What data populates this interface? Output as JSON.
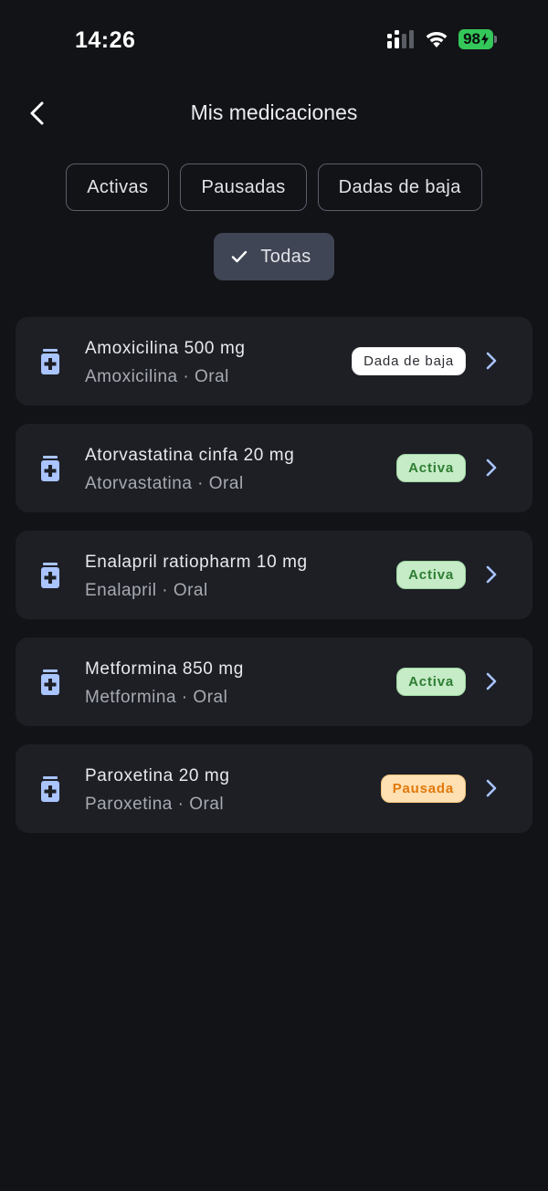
{
  "status_bar": {
    "time": "14:26",
    "battery": "98"
  },
  "header": {
    "title": "Mis medicaciones"
  },
  "filters": {
    "chips": [
      {
        "label": "Activas",
        "selected": false
      },
      {
        "label": "Pausadas",
        "selected": false
      },
      {
        "label": "Dadas de baja",
        "selected": false
      },
      {
        "label": "Todas",
        "selected": true
      }
    ]
  },
  "medications": [
    {
      "name": "Amoxicilina 500 mg",
      "subtitle": "Amoxicilina · Oral",
      "status": "Dada de baja",
      "status_type": "baja"
    },
    {
      "name": "Atorvastatina cinfa 20 mg",
      "subtitle": "Atorvastatina · Oral",
      "status": "Activa",
      "status_type": "activa"
    },
    {
      "name": "Enalapril ratiopharm 10 mg",
      "subtitle": "Enalapril · Oral",
      "status": "Activa",
      "status_type": "activa"
    },
    {
      "name": "Metformina 850 mg",
      "subtitle": "Metformina · Oral",
      "status": "Activa",
      "status_type": "activa"
    },
    {
      "name": "Paroxetina 20 mg",
      "subtitle": "Paroxetina · Oral",
      "status": "Pausada",
      "status_type": "pausada"
    }
  ],
  "colors": {
    "background": "#121317",
    "card": "#1d1f25",
    "icon_accent": "#a9c4ff",
    "chevron": "#a9c4ff",
    "active_badge_bg": "#c6ebc7",
    "active_badge_text": "#2e7d32",
    "paused_badge_bg": "#ffe0b2",
    "paused_badge_text": "#e0790b",
    "battery": "#34c759"
  },
  "icons": {
    "back": "chevron-left-icon",
    "check": "checkmark-icon",
    "medication": "pill-bottle-icon",
    "row_chevron": "chevron-right-icon",
    "signal": "cellular-signal-icon",
    "wifi": "wifi-icon",
    "battery": "battery-charging-icon"
  }
}
